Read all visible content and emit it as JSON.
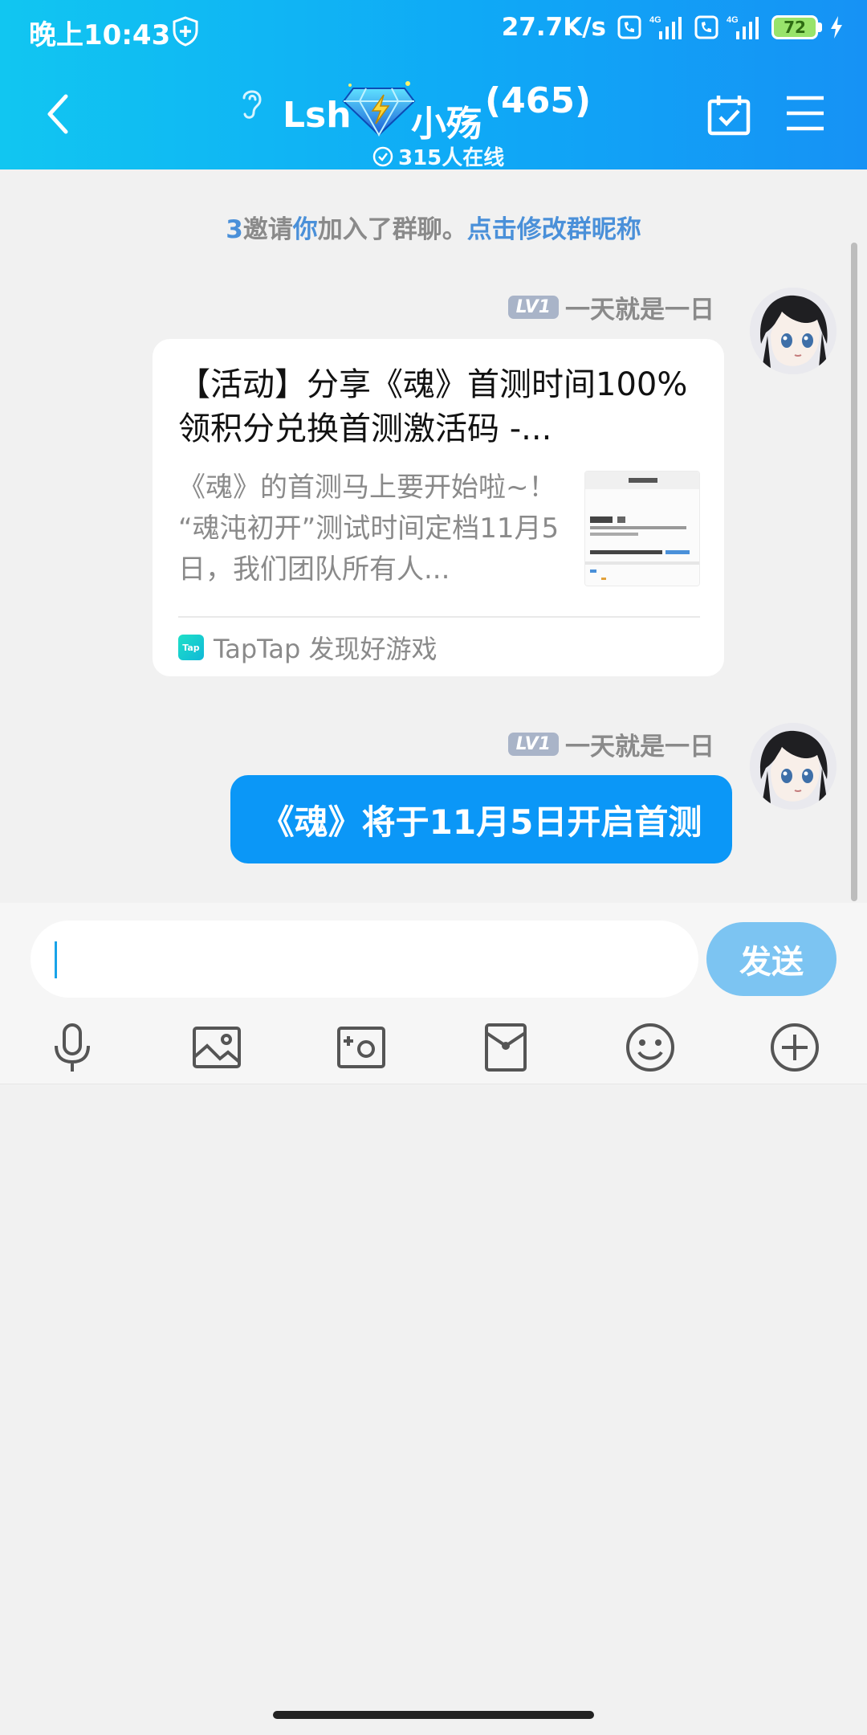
{
  "status_bar": {
    "time": "晚上10:43",
    "net_speed": "27.7K/s",
    "network_1": "4G",
    "network_2": "4G",
    "battery": "72"
  },
  "nav": {
    "title_left": "Lsh",
    "title_right": "小殇",
    "member_count": "(465)",
    "online": "315人在线"
  },
  "system_message": {
    "inviter": "3",
    "verb": "邀请",
    "invitee": "你",
    "rest": "加入了群聊。",
    "action": "点击修改群昵称"
  },
  "messages": [
    {
      "level": "LV1",
      "sender": "一天就是一日",
      "type": "link-card",
      "title": "【活动】分享《魂》首测时间100%领积分兑换首测激活码 -...",
      "description": "《魂》的首测马上要开始啦~！ “魂沌初开”测试时间定档11月5日，我们团队所有人...",
      "source": "TapTap 发现好游戏",
      "source_logo_text": "Tap"
    },
    {
      "level": "LV1",
      "sender": "一天就是一日",
      "type": "text",
      "text": "《魂》将于11月5日开启首测"
    }
  ],
  "input": {
    "value": "",
    "send_label": "发送"
  },
  "toolbar": [
    "microphone-icon",
    "image-icon",
    "camera-icon",
    "red-packet-icon",
    "emoji-icon",
    "plus-icon"
  ],
  "colors": {
    "header_start": "#11c6f1",
    "header_end": "#1692f5",
    "bubble": "#0b97f7",
    "send_button": "#7cc4f2",
    "link": "#4a90d9",
    "level_badge": "#a9b4c8"
  }
}
